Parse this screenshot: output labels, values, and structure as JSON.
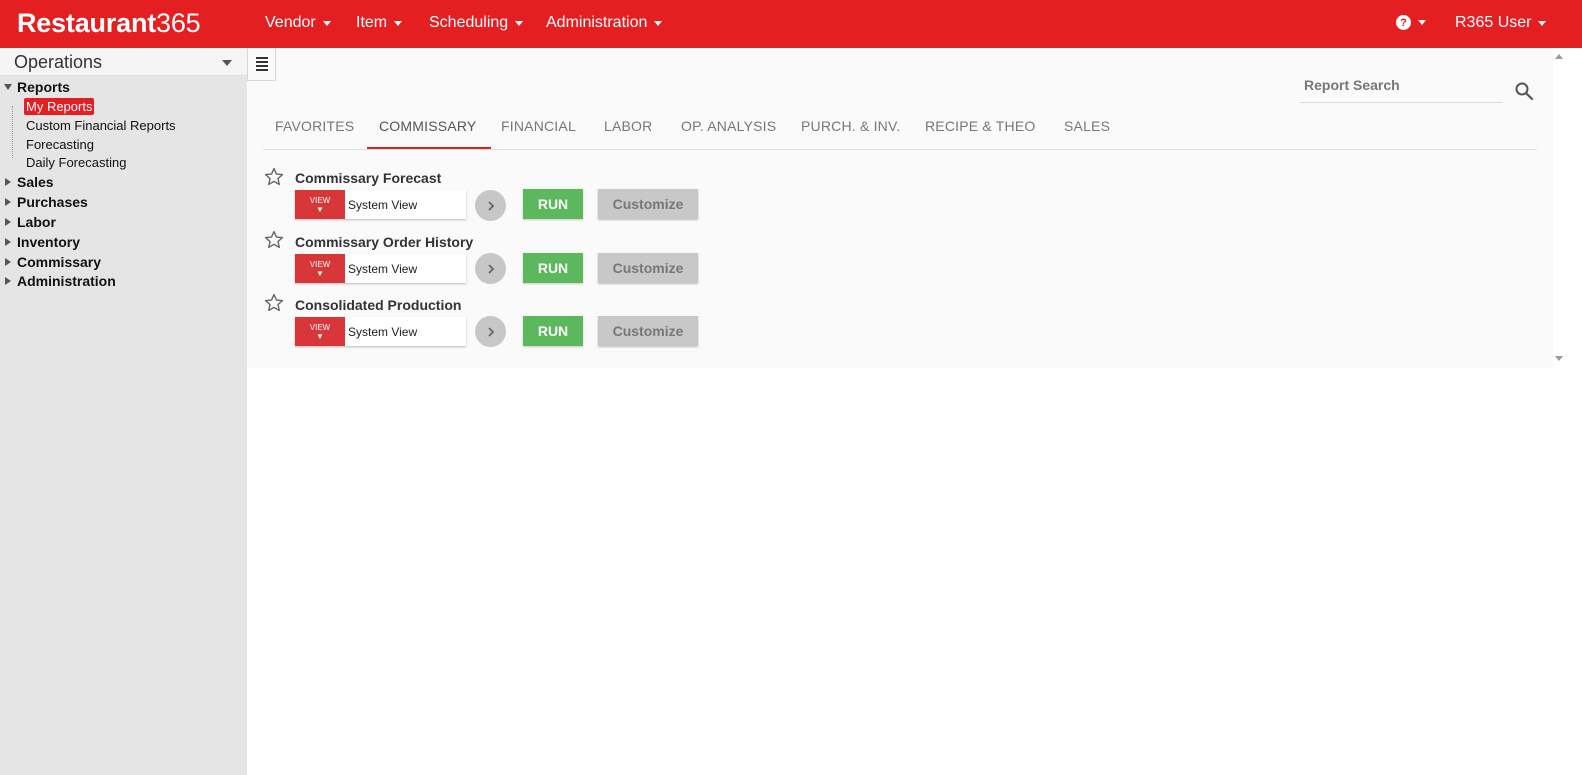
{
  "brand": {
    "name_bold": "Restaurant",
    "name_light": "365",
    "color": "#e31f22"
  },
  "nav": {
    "items": [
      {
        "label": "Vendor"
      },
      {
        "label": "Item"
      },
      {
        "label": "Scheduling"
      },
      {
        "label": "Administration"
      }
    ],
    "help_icon": "question-circle-icon",
    "user_label": "R365 User"
  },
  "sidebar": {
    "title": "Operations",
    "tree": {
      "reports_label": "Reports",
      "children": [
        "My Reports",
        "Custom Financial Reports",
        "Forecasting",
        "Daily Forecasting"
      ],
      "active_child": "My Reports",
      "sections": [
        "Sales",
        "Purchases",
        "Labor",
        "Inventory",
        "Commissary",
        "Administration"
      ]
    }
  },
  "search": {
    "placeholder": "Report Search"
  },
  "tabs": [
    "FAVORITES",
    "COMMISSARY",
    "FINANCIAL",
    "LABOR",
    "OP. ANALYSIS",
    "PURCH. & INV.",
    "RECIPE & THEO",
    "SALES"
  ],
  "active_tab": "COMMISSARY",
  "reports": [
    {
      "title": "Commissary Forecast",
      "view_label": "VIEW",
      "view_value": "System View",
      "run_label": "RUN",
      "customize_label": "Customize"
    },
    {
      "title": "Commissary Order History",
      "view_label": "VIEW",
      "view_value": "System View",
      "run_label": "RUN",
      "customize_label": "Customize"
    },
    {
      "title": "Consolidated Production",
      "view_label": "VIEW",
      "view_value": "System View",
      "run_label": "RUN",
      "customize_label": "Customize"
    }
  ],
  "colors": {
    "run": "#5cb85c",
    "customize": "#c8c8c8",
    "view": "#d9363a"
  }
}
